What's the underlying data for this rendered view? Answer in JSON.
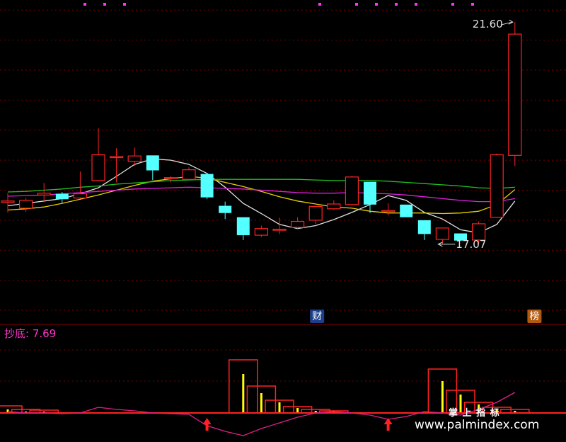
{
  "chart_data": [
    {
      "type": "candlestick",
      "title": "",
      "price_scale": {
        "min": 16.8,
        "max": 21.85
      },
      "price_ticks": [
        16.8,
        17.3,
        17.8,
        18.3,
        18.8,
        19.3,
        19.8,
        20.3,
        20.8,
        21.3,
        21.8
      ],
      "candles": [
        {
          "o": 18.6,
          "h": 18.75,
          "l": 18.43,
          "c": 18.62
        },
        {
          "o": 18.5,
          "h": 18.67,
          "l": 18.44,
          "c": 18.63
        },
        {
          "o": 18.72,
          "h": 18.92,
          "l": 18.6,
          "c": 18.75
        },
        {
          "o": 18.74,
          "h": 18.77,
          "l": 18.59,
          "c": 18.65
        },
        {
          "o": 18.67,
          "h": 19.11,
          "l": 18.66,
          "c": 18.74
        },
        {
          "o": 18.96,
          "h": 19.83,
          "l": 18.95,
          "c": 19.39
        },
        {
          "o": 19.36,
          "h": 19.5,
          "l": 18.93,
          "c": 19.36
        },
        {
          "o": 19.28,
          "h": 19.51,
          "l": 19.2,
          "c": 19.37
        },
        {
          "o": 19.38,
          "h": 19.38,
          "l": 18.97,
          "c": 19.13
        },
        {
          "o": 19.01,
          "h": 19.03,
          "l": 18.93,
          "c": 19.01
        },
        {
          "o": 18.98,
          "h": 19.18,
          "l": 18.98,
          "c": 19.14
        },
        {
          "o": 19.07,
          "h": 19.07,
          "l": 18.65,
          "c": 18.68
        },
        {
          "o": 18.54,
          "h": 18.61,
          "l": 18.32,
          "c": 18.42
        },
        {
          "o": 18.35,
          "h": 18.35,
          "l": 17.97,
          "c": 18.05
        },
        {
          "o": 18.05,
          "h": 18.21,
          "l": 18.02,
          "c": 18.16
        },
        {
          "o": 18.15,
          "h": 18.34,
          "l": 18.07,
          "c": 18.15
        },
        {
          "o": 18.18,
          "h": 18.35,
          "l": 18.16,
          "c": 18.28
        },
        {
          "o": 18.3,
          "h": 18.53,
          "l": 18.24,
          "c": 18.53
        },
        {
          "o": 18.49,
          "h": 18.63,
          "l": 18.47,
          "c": 18.57
        },
        {
          "o": 18.56,
          "h": 19.04,
          "l": 18.55,
          "c": 19.02
        },
        {
          "o": 18.94,
          "h": 18.94,
          "l": 18.42,
          "c": 18.56
        },
        {
          "o": 18.46,
          "h": 18.58,
          "l": 18.38,
          "c": 18.46
        },
        {
          "o": 18.56,
          "h": 18.56,
          "l": 18.35,
          "c": 18.35
        },
        {
          "o": 18.3,
          "h": 18.3,
          "l": 17.97,
          "c": 18.07
        },
        {
          "o": 17.98,
          "h": 18.16,
          "l": 17.9,
          "c": 18.17
        },
        {
          "o": 18.08,
          "h": 18.08,
          "l": 17.95,
          "c": 17.96
        },
        {
          "o": 17.97,
          "h": 18.28,
          "l": 17.91,
          "c": 18.24
        },
        {
          "o": 18.35,
          "h": 19.41,
          "l": 18.34,
          "c": 19.39
        },
        {
          "o": 19.38,
          "h": 21.6,
          "l": 19.2,
          "c": 21.4
        }
      ],
      "moving_averages": [
        {
          "color": "#e0e0e0",
          "values": [
            18.54,
            18.58,
            18.62,
            18.66,
            18.74,
            18.84,
            19.03,
            19.23,
            19.32,
            19.3,
            19.23,
            19.08,
            18.85,
            18.58,
            18.41,
            18.23,
            18.16,
            18.21,
            18.31,
            18.43,
            18.56,
            18.71,
            18.63,
            18.43,
            18.32,
            18.14,
            18.09,
            18.23,
            18.62
          ]
        },
        {
          "color": "#e8d000",
          "values": [
            18.47,
            18.49,
            18.52,
            18.58,
            18.65,
            18.72,
            18.8,
            18.88,
            18.95,
            18.99,
            19.03,
            19.0,
            18.93,
            18.86,
            18.78,
            18.69,
            18.62,
            18.57,
            18.52,
            18.5,
            18.45,
            18.42,
            18.42,
            18.42,
            18.41,
            18.42,
            18.45,
            18.56,
            18.81
          ]
        },
        {
          "color": "#e020e0",
          "values": [
            18.7,
            18.71,
            18.72,
            18.74,
            18.76,
            18.78,
            18.8,
            18.82,
            18.83,
            18.84,
            18.85,
            18.84,
            18.83,
            18.82,
            18.8,
            18.78,
            18.76,
            18.75,
            18.75,
            18.76,
            18.75,
            18.74,
            18.72,
            18.69,
            18.66,
            18.63,
            18.61,
            18.61,
            18.66
          ]
        },
        {
          "color": "#20c020",
          "values": [
            18.77,
            18.78,
            18.8,
            18.82,
            18.85,
            18.87,
            18.9,
            18.92,
            18.94,
            18.96,
            18.97,
            18.98,
            18.98,
            18.98,
            18.98,
            18.98,
            18.98,
            18.97,
            18.96,
            18.96,
            18.96,
            18.95,
            18.93,
            18.91,
            18.89,
            18.87,
            18.84,
            18.83,
            18.85
          ]
        }
      ],
      "annotations": {
        "high_label": "21.60",
        "low_label": "17.07",
        "markers": [
          "财",
          "榜"
        ]
      }
    },
    {
      "type": "bar",
      "indicator_label": "抄底: 7.69",
      "bars": [
        {
          "x": 0,
          "outer": 10,
          "inner": 5
        },
        {
          "x": 1,
          "outer": 5,
          "inner": 2
        },
        {
          "x": 2,
          "outer": 4,
          "inner": 2
        },
        {
          "x": 13,
          "outer": 75,
          "inner": 55
        },
        {
          "x": 14,
          "outer": 38,
          "inner": 28
        },
        {
          "x": 15,
          "outer": 18,
          "inner": 15
        },
        {
          "x": 16,
          "outer": 9,
          "inner": 7
        },
        {
          "x": 17,
          "outer": 5,
          "inner": 3
        },
        {
          "x": 18,
          "outer": 3,
          "inner": 2
        },
        {
          "x": 24,
          "outer": 62,
          "inner": 45
        },
        {
          "x": 25,
          "outer": 32,
          "inner": 26
        },
        {
          "x": 26,
          "outer": 15,
          "inner": 12
        },
        {
          "x": 27,
          "outer": 8,
          "inner": 6
        },
        {
          "x": 28,
          "outer": 5,
          "inner": 3
        }
      ],
      "line_values": [
        2,
        0,
        0,
        -1,
        0,
        8,
        5,
        3,
        0,
        -1,
        -2,
        -18,
        -26,
        -32,
        -22,
        -14,
        -6,
        0,
        2,
        0,
        -3,
        -9,
        -5,
        2,
        0,
        -3,
        5,
        15,
        29
      ],
      "arrow_positions": [
        11,
        21
      ]
    }
  ],
  "watermark": {
    "line1": "掌 上 指 标",
    "line2": "www.palmindex.com"
  },
  "colors": {
    "up": "#ff2222",
    "down": "#54ffff",
    "bg": "#000000",
    "grid": "#7a0000",
    "indicator_label": "#ff33cc",
    "yellow": "#ffff00"
  }
}
